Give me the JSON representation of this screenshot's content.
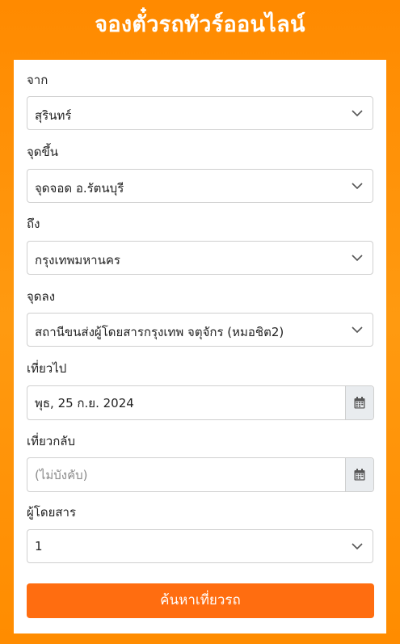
{
  "page": {
    "title": "จองตั๋วรถทัวร์ออนไลน์"
  },
  "form": {
    "from": {
      "label": "จาก",
      "value": "สุรินทร์"
    },
    "pickup": {
      "label": "จุดขึ้น",
      "value": "จุดจอด อ.รัตนบุรี"
    },
    "to": {
      "label": "ถึง",
      "value": "กรุงเทพมหานคร"
    },
    "dropoff": {
      "label": "จุดลง",
      "value": "สถานีขนส่งผู้โดยสารกรุงเทพ จตุจักร (หมอชิต2)"
    },
    "depart": {
      "label": "เที่ยวไป",
      "value": "พุธ, 25 ก.ย. 2024"
    },
    "return": {
      "label": "เที่ยวกลับ",
      "placeholder": "(ไม่บังคับ)"
    },
    "passengers": {
      "label": "ผู้โดยสาร",
      "value": "1"
    },
    "submit_label": "ค้นหาเที่ยวรถ"
  },
  "icons": {
    "dropdown": "chevron-down-icon",
    "date": "calendar-icon"
  },
  "colors": {
    "background": "#ff8c00",
    "button": "#ff6d10",
    "card": "#ffffff"
  }
}
